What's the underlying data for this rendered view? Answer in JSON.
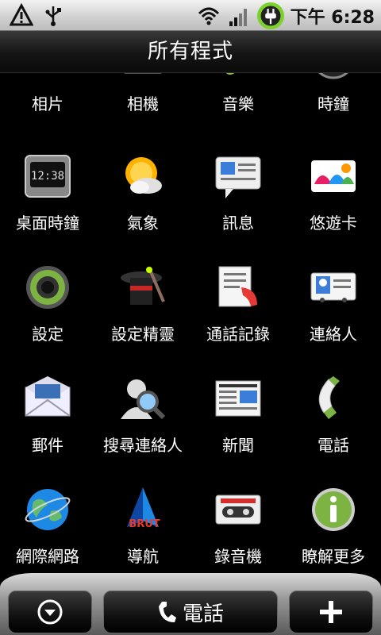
{
  "status_bar": {
    "time": "下午 6:28",
    "icons": [
      "warning-icon",
      "usb-icon",
      "wifi-icon",
      "signal-icon",
      "charging-icon"
    ]
  },
  "title": "所有程式",
  "apps": [
    {
      "label": "相片",
      "icon": "photos-icon"
    },
    {
      "label": "相機",
      "icon": "camera-icon"
    },
    {
      "label": "音樂",
      "icon": "music-icon"
    },
    {
      "label": "時鐘",
      "icon": "clock-icon"
    },
    {
      "label": "桌面時鐘",
      "icon": "desk-clock-icon"
    },
    {
      "label": "氣象",
      "icon": "weather-icon"
    },
    {
      "label": "訊息",
      "icon": "messages-icon"
    },
    {
      "label": "悠遊卡",
      "icon": "easycard-icon"
    },
    {
      "label": "設定",
      "icon": "settings-icon"
    },
    {
      "label": "設定精靈",
      "icon": "setup-wizard-icon"
    },
    {
      "label": "通話記錄",
      "icon": "call-history-icon"
    },
    {
      "label": "連絡人",
      "icon": "contacts-icon"
    },
    {
      "label": "郵件",
      "icon": "mail-icon"
    },
    {
      "label": "搜尋連絡人",
      "icon": "search-contacts-icon"
    },
    {
      "label": "新聞",
      "icon": "news-icon"
    },
    {
      "label": "電話",
      "icon": "phone-icon"
    },
    {
      "label": "網際網路",
      "icon": "internet-icon"
    },
    {
      "label": "導航",
      "icon": "navigation-icon"
    },
    {
      "label": "錄音機",
      "icon": "recorder-icon"
    },
    {
      "label": "瞭解更多",
      "icon": "info-icon"
    }
  ],
  "navigation_icon_text": "BRUT",
  "dock": {
    "left_icon": "collapse-icon",
    "center_label": "電話",
    "center_icon": "phone-icon",
    "right_icon": "add-icon"
  }
}
